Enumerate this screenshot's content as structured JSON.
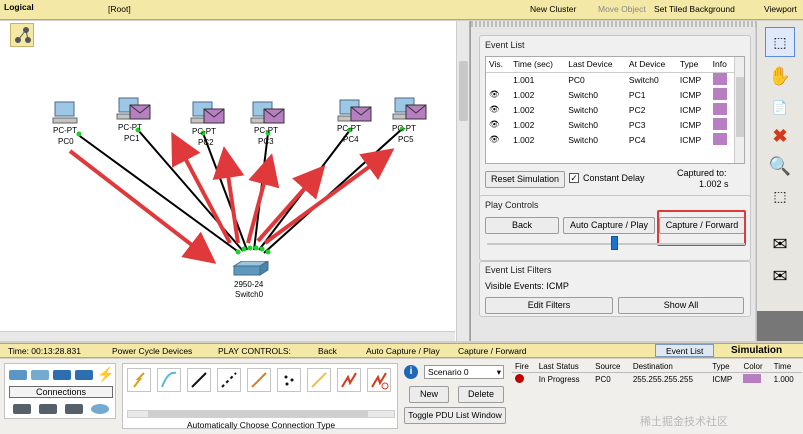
{
  "topbar": {
    "logical": "Logical",
    "root": "[Root]",
    "new_cluster": "New Cluster",
    "move_object": "Move Object",
    "tiled_bg": "Set Tiled Background",
    "viewport": "Viewport"
  },
  "devices": [
    {
      "type": "PC-PT",
      "name": "PC0"
    },
    {
      "type": "PC-PT",
      "name": "PC1"
    },
    {
      "type": "PC-PT",
      "name": "PC2"
    },
    {
      "type": "PC-PT",
      "name": "PC3"
    },
    {
      "type": "PC-PT",
      "name": "PC4"
    },
    {
      "type": "PC-PT",
      "name": "PC5"
    },
    {
      "type": "2950-24",
      "name": "Switch0"
    }
  ],
  "event_list": {
    "title": "Event List",
    "headers": [
      "Vis.",
      "Time (sec)",
      "Last Device",
      "At Device",
      "Type",
      "Info"
    ],
    "rows": [
      {
        "vis": "",
        "time": "1.001",
        "last": "PC0",
        "at": "Switch0",
        "type": "ICMP"
      },
      {
        "vis": "eye",
        "time": "1.002",
        "last": "Switch0",
        "at": "PC1",
        "type": "ICMP"
      },
      {
        "vis": "eye",
        "time": "1.002",
        "last": "Switch0",
        "at": "PC2",
        "type": "ICMP"
      },
      {
        "vis": "eye",
        "time": "1.002",
        "last": "Switch0",
        "at": "PC3",
        "type": "ICMP"
      },
      {
        "vis": "eye",
        "time": "1.002",
        "last": "Switch0",
        "at": "PC4",
        "type": "ICMP"
      }
    ],
    "info_color": "#b77fc1",
    "reset_label": "Reset Simulation",
    "constant_delay_label": "Constant Delay",
    "captured_to_label": "Captured to:",
    "captured_to_value": "1.002 s"
  },
  "play_controls": {
    "title": "Play Controls",
    "back": "Back",
    "auto_capture": "Auto Capture / Play",
    "capture_forward": "Capture / Forward"
  },
  "filters": {
    "title": "Event List Filters",
    "visible_events": "Visible Events:  ICMP",
    "edit_filters": "Edit Filters",
    "show_all": "Show All"
  },
  "rtbar": {
    "time": "Time: 00:13:28.831",
    "power_cycle": "Power Cycle Devices",
    "play_controls": "PLAY CONTROLS:",
    "back": "Back",
    "auto_capture": "Auto Capture / Play",
    "capture_forward": "Capture / Forward",
    "event_list": "Event List",
    "simulation": "Simulation"
  },
  "bottom": {
    "connections_label": "Connections",
    "auto_connection": "Automatically Choose Connection Type",
    "scenario": "Scenario 0",
    "new_label": "New",
    "delete_label": "Delete",
    "toggle_pdu": "Toggle PDU List Window",
    "pdu_headers": [
      "Fire",
      "Last Status",
      "Source",
      "Destination",
      "Type",
      "Color",
      "Time"
    ],
    "pdu_row": {
      "status": "In Progress",
      "source": "PC0",
      "dest": "255.255.255.255",
      "type": "ICMP",
      "color": "#b77fc1",
      "time": "1.000"
    }
  },
  "watermark": "稀土掘金技术社区"
}
